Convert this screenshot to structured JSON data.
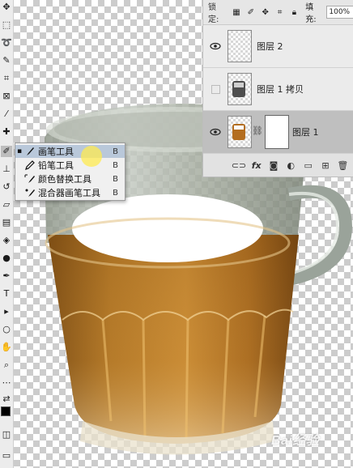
{
  "toolbar": {
    "tools": [
      {
        "name": "move-tool",
        "glyph": "✥"
      },
      {
        "name": "marquee-tool",
        "glyph": "⬚"
      },
      {
        "name": "lasso-tool",
        "glyph": "➰"
      },
      {
        "name": "quick-select-tool",
        "glyph": "✎"
      },
      {
        "name": "crop-tool",
        "glyph": "⌗"
      },
      {
        "name": "slice-tool",
        "glyph": "⊠"
      },
      {
        "name": "eyedropper-tool",
        "glyph": "⁄"
      },
      {
        "name": "healing-tool",
        "glyph": "✚"
      },
      {
        "name": "brush-tool",
        "glyph": "✐"
      },
      {
        "name": "stamp-tool",
        "glyph": "⊥"
      },
      {
        "name": "history-brush-tool",
        "glyph": "↺"
      },
      {
        "name": "eraser-tool",
        "glyph": "▱"
      },
      {
        "name": "gradient-tool",
        "glyph": "▤"
      },
      {
        "name": "blur-tool",
        "glyph": "◈"
      },
      {
        "name": "dodge-tool",
        "glyph": "●"
      },
      {
        "name": "pen-tool",
        "glyph": "✒"
      },
      {
        "name": "type-tool",
        "glyph": "T"
      },
      {
        "name": "path-select-tool",
        "glyph": "▸"
      },
      {
        "name": "shape-tool",
        "glyph": "○"
      },
      {
        "name": "hand-tool",
        "glyph": "✋"
      },
      {
        "name": "zoom-tool",
        "glyph": "⌕"
      },
      {
        "name": "more-tools",
        "glyph": "⋯"
      },
      {
        "name": "swap-colors",
        "glyph": "⇄"
      }
    ],
    "foreground_color": "#000000",
    "background_color": "#ffffff"
  },
  "layers_panel": {
    "lock_label": "锁定:",
    "fill_label": "填充:",
    "fill_value": "100%",
    "layers": [
      {
        "name": "图层 2",
        "visible": true,
        "selected": false
      },
      {
        "name": "图层 1 拷贝",
        "visible": false,
        "selected": false
      },
      {
        "name": "图层 1",
        "visible": true,
        "selected": true
      }
    ],
    "footer_icons": [
      "link-icon",
      "fx-icon",
      "mask-icon",
      "adjustment-icon",
      "group-icon",
      "new-layer-icon",
      "trash-icon"
    ],
    "footer_fx": "fx"
  },
  "flyout": {
    "items": [
      {
        "label": "画笔工具",
        "key": "B",
        "icon": "brush-icon",
        "current": true
      },
      {
        "label": "铅笔工具",
        "key": "B",
        "icon": "pencil-icon",
        "current": false
      },
      {
        "label": "颜色替换工具",
        "key": "B",
        "icon": "color-replace-icon",
        "current": false
      },
      {
        "label": "混合器画笔工具",
        "key": "B",
        "icon": "mixer-brush-icon",
        "current": false
      }
    ]
  },
  "watermark": "Bai经验"
}
